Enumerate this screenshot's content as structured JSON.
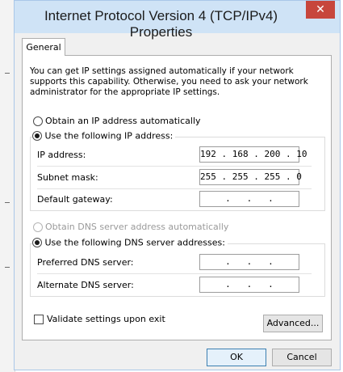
{
  "window": {
    "title": "Internet Protocol Version 4 (TCP/IPv4) Properties",
    "close_glyph": "✕"
  },
  "tabs": [
    {
      "label": "General"
    }
  ],
  "general": {
    "description": "You can get IP settings assigned automatically if your network supports this capability. Otherwise, you need to ask your network administrator for the appropriate IP settings.",
    "ip": {
      "auto_label": "Obtain an IP address automatically",
      "manual_label": "Use the following IP address:",
      "selected": "manual",
      "fields": [
        {
          "label": "IP address:",
          "value": "192 . 168 . 200 . 10"
        },
        {
          "label": "Subnet mask:",
          "value": "255 . 255 . 255 . 0"
        },
        {
          "label": "Default gateway:",
          "value": " .   .   . "
        }
      ]
    },
    "dns": {
      "auto_label": "Obtain DNS server address automatically",
      "auto_disabled": true,
      "manual_label": "Use the following DNS server addresses:",
      "selected": "manual",
      "fields": [
        {
          "label": "Preferred DNS server:",
          "value": " .   .   . "
        },
        {
          "label": "Alternate DNS server:",
          "value": " .   .   . "
        }
      ]
    },
    "validate_label": "Validate settings upon exit",
    "validate_checked": false,
    "advanced_label": "Advanced..."
  },
  "buttons": {
    "ok": "OK",
    "cancel": "Cancel"
  },
  "colors": {
    "titlebar": "#cfe3f6",
    "close": "#c7463c",
    "dialog_bg": "#f0f0f0"
  }
}
